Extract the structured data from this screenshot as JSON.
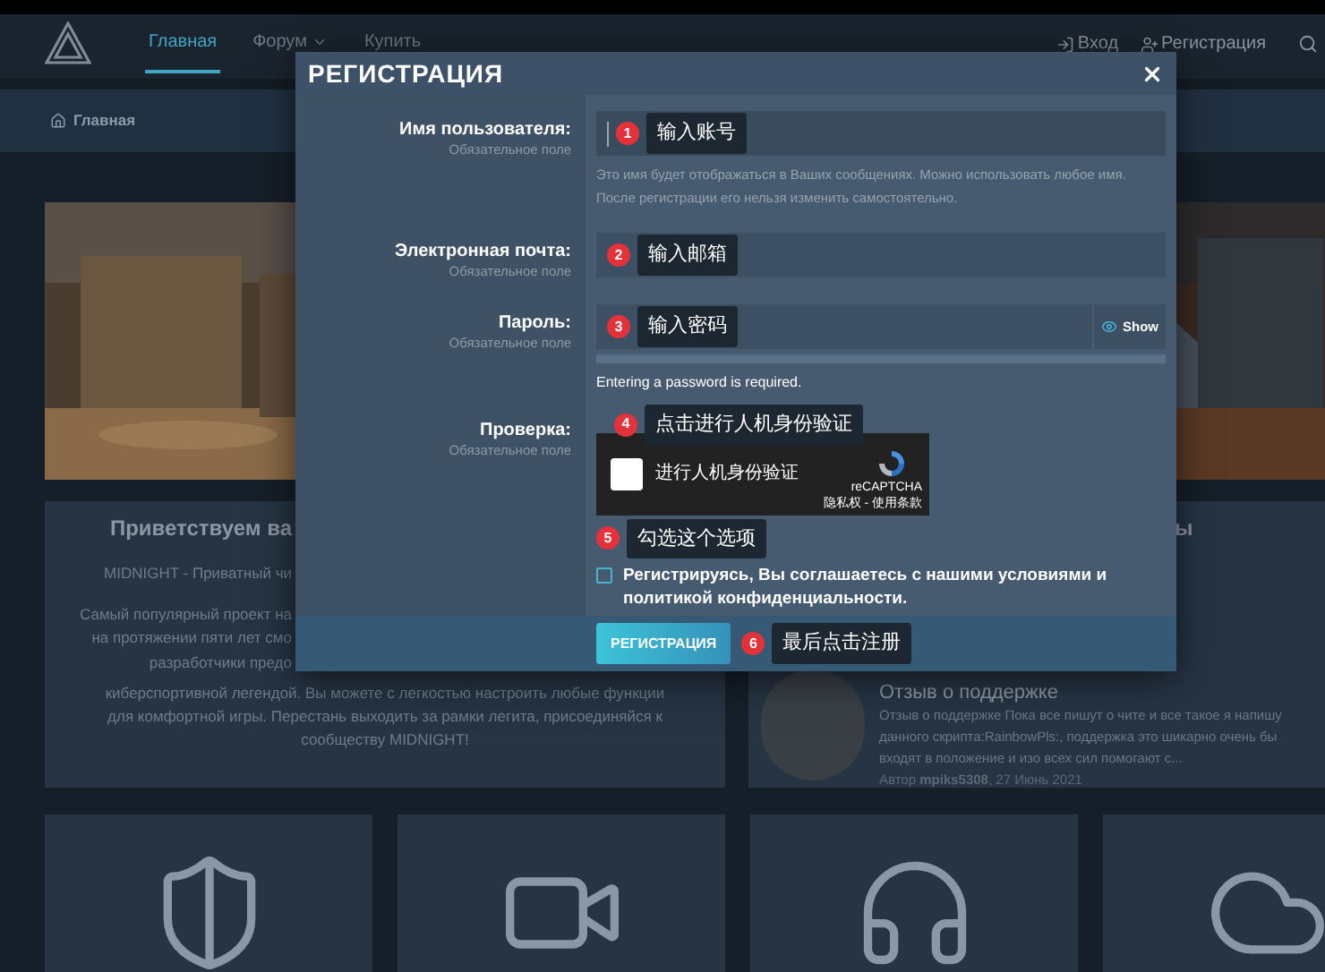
{
  "nav": {
    "items": [
      {
        "label": "Главная",
        "selected": true,
        "kind": "link"
      },
      {
        "label": "Форум",
        "selected": false,
        "kind": "dropdown"
      },
      {
        "label": "Купить",
        "selected": false,
        "kind": "link"
      }
    ],
    "actions": [
      {
        "label": "Вход",
        "kind": "login"
      },
      {
        "label": "Регистрация",
        "kind": "register"
      }
    ]
  },
  "breadcrumb": {
    "label": "Главная"
  },
  "welcome_card": {
    "title": "Приветствуем ва",
    "tagline": "MIDNIGHT - Приватный чи",
    "cut_lines": [
      "Самый популярный проект на",
      "на протяжении пяти лет смо",
      "разработчики предо"
    ],
    "lines": [
      "киберспортивной легендой. Вы можете с легкостью настроить любые функции",
      "для комфортной игры. Перестань выходить за рамки легита, присоединяйся к",
      "сообществу MIDNIGHT!"
    ]
  },
  "review_card": {
    "title_fragment": "ы",
    "review_title": "Отзыв о поддержке",
    "lines": [
      "Отзыв о поддержке Пока все пишут о чите и все такое я напишу",
      "данного скрипта:RainbowPls:, поддержка это шикарно очень бы",
      "входят в положение и изо всех сил помогают с..."
    ],
    "meta": "Автор **mpiks5308**, 27 Июнь 2021"
  },
  "feature_cards": [
    {
      "kind": "shield"
    },
    {
      "kind": "video"
    },
    {
      "kind": "headset"
    },
    {
      "kind": "cloud"
    }
  ],
  "dialog": {
    "title": "РЕГИСТРАЦИЯ",
    "fields": [
      {
        "kind": "text",
        "label": "Имя пользователя:",
        "note": "Обязательное поле",
        "focused": true,
        "annotation": {
          "number": "1",
          "text": "输入账号"
        },
        "hint": "Это имя будет отображаться в Ваших сообщениях. Можно использовать любое имя. После регистрации его нельзя изменить самостоятельно."
      },
      {
        "kind": "text",
        "label": "Электронная почта:",
        "note": "Обязательное поле",
        "focused": false,
        "annotation": {
          "number": "2",
          "text": "输入邮箱"
        }
      },
      {
        "kind": "password",
        "label": "Пароль:",
        "note": "Обязательное поле",
        "focused": false,
        "annotation": {
          "number": "3",
          "text": "输入密码"
        },
        "toggle": "Show",
        "strength": {
          "level": 0
        },
        "message": "Entering a password is required."
      }
    ],
    "captcha": {
      "label": "Проверка:",
      "note": "Обязательное поле",
      "annotation": {
        "number": "4",
        "text": "点击进行人机身份验证"
      },
      "checkbox_label": "进行人机身份验证",
      "checked": false,
      "brand": "reCAPTCHA",
      "links": "隐私权 - 使用条款"
    },
    "terms": {
      "annotation": {
        "number": "5",
        "text": "勾选这个选项"
      },
      "checked": false,
      "text": "Регистрируясь, Вы соглашаетесь с нашими условиями и политикой конфиденциальности."
    },
    "submit": {
      "label": "РЕГИСТРАЦИЯ",
      "annotation": {
        "number": "6",
        "text": "最后点击注册"
      }
    }
  }
}
